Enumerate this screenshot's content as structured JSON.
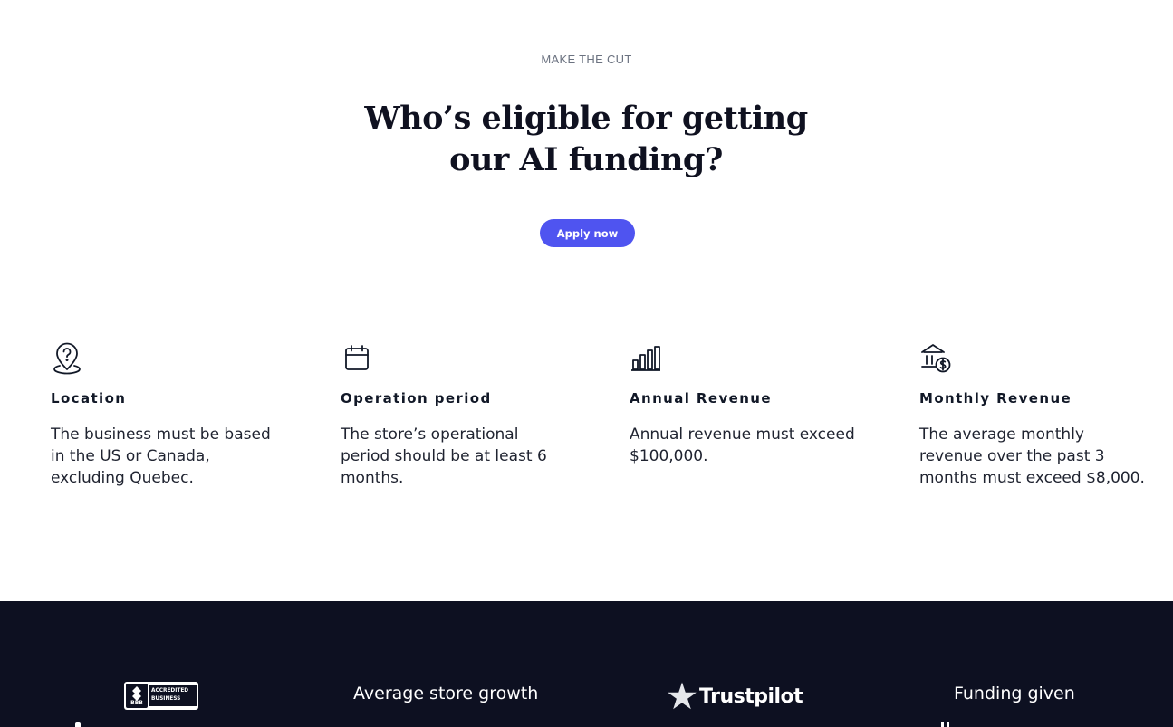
{
  "hero": {
    "eyebrow": "MAKE THE CUT",
    "title_line1": "Who’s eligible for getting",
    "title_line2": "our AI funding?",
    "cta_label": "Apply now",
    "accent_color": "#4f54f0"
  },
  "criteria": [
    {
      "icon": "location-pin-icon",
      "title": "Location",
      "body": "The business must be based in the US or Canada, excluding Quebec."
    },
    {
      "icon": "calendar-icon",
      "title": "Operation period",
      "body": "The store’s operational period should be at least 6 months."
    },
    {
      "icon": "bar-chart-icon",
      "title": "Annual Revenue",
      "body": "Annual revenue must exceed $100,000."
    },
    {
      "icon": "bank-dollar-icon",
      "title": "Monthly Revenue",
      "body": "The average monthly revenue over the past 3 months must exceed $8,000."
    }
  ],
  "trust_bar": {
    "background_color": "#0d1021",
    "bbb_seal": "BBB",
    "bbb_badge_line1": "ACCREDITED",
    "bbb_badge_line2": "BUSINESS",
    "avg_store_growth_label": "Average store growth",
    "trustpilot_label": "Trustpilot",
    "funding_given_label": "Funding given"
  }
}
